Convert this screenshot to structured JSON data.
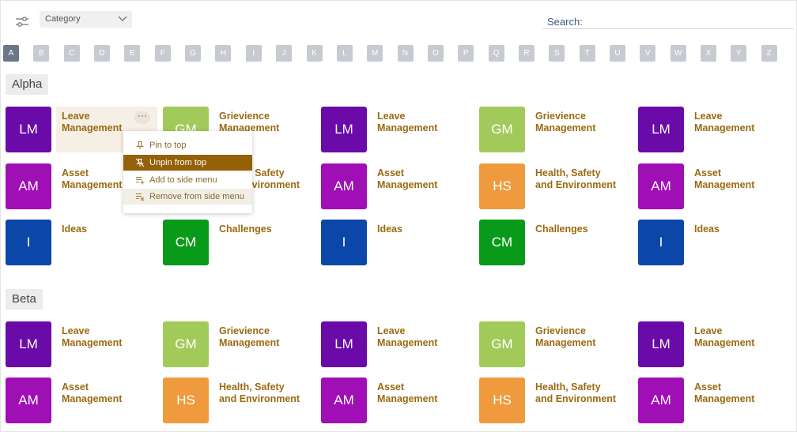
{
  "toolbar": {
    "filter_icon": "filter-sliders-icon",
    "category_label": "Category",
    "search_label": "Search:",
    "search_value": ""
  },
  "letters": [
    "A",
    "B",
    "C",
    "D",
    "E",
    "F",
    "G",
    "H",
    "I",
    "J",
    "K",
    "L",
    "M",
    "N",
    "O",
    "P",
    "Q",
    "R",
    "S",
    "T",
    "U",
    "V",
    "W",
    "X",
    "Y",
    "Z"
  ],
  "active_letter": "A",
  "colors": {
    "purple": "#6a0aa8",
    "magenta": "#a00fb6",
    "lime": "#a2ca5a",
    "orange": "#ef9a3d",
    "green": "#0a9a1a",
    "blue": "#0a47a8",
    "label": "#9a6a12",
    "menu_selected": "#946008"
  },
  "sections": [
    {
      "title": "Alpha",
      "rows": [
        [
          {
            "abbr": "LM",
            "label": [
              "Leave",
              "Management"
            ],
            "color": "#6a0aa8"
          },
          {
            "abbr": "GM",
            "label": [
              "Grievience",
              "Management"
            ],
            "color": "#a2ca5a"
          },
          {
            "abbr": "LM",
            "label": [
              "Leave",
              "Management"
            ],
            "color": "#6a0aa8"
          },
          {
            "abbr": "GM",
            "label": [
              "Grievience",
              "Management"
            ],
            "color": "#a2ca5a"
          },
          {
            "abbr": "LM",
            "label": [
              "Leave",
              "Management"
            ],
            "color": "#6a0aa8"
          }
        ],
        [
          {
            "abbr": "AM",
            "label": [
              "Asset",
              "Management"
            ],
            "color": "#a00fb6"
          },
          {
            "abbr": "HS",
            "label": [
              "Health, Safety",
              "and Environment"
            ],
            "color": "#ef9a3d"
          },
          {
            "abbr": "AM",
            "label": [
              "Asset",
              "Management"
            ],
            "color": "#a00fb6"
          },
          {
            "abbr": "HS",
            "label": [
              "Health, Safety",
              "and Environment"
            ],
            "color": "#ef9a3d"
          },
          {
            "abbr": "AM",
            "label": [
              "Asset",
              "Management"
            ],
            "color": "#a00fb6"
          }
        ],
        [
          {
            "abbr": "I",
            "label": [
              "Ideas",
              ""
            ],
            "color": "#0a47a8"
          },
          {
            "abbr": "CM",
            "label": [
              "Challenges",
              ""
            ],
            "color": "#0a9a1a"
          },
          {
            "abbr": "I",
            "label": [
              "Ideas",
              ""
            ],
            "color": "#0a47a8"
          },
          {
            "abbr": "CM",
            "label": [
              "Challenges",
              ""
            ],
            "color": "#0a9a1a"
          },
          {
            "abbr": "I",
            "label": [
              "Ideas",
              ""
            ],
            "color": "#0a47a8"
          }
        ]
      ]
    },
    {
      "title": "Beta",
      "rows": [
        [
          {
            "abbr": "LM",
            "label": [
              "Leave",
              "Management"
            ],
            "color": "#6a0aa8"
          },
          {
            "abbr": "GM",
            "label": [
              "Grievience",
              "Management"
            ],
            "color": "#a2ca5a"
          },
          {
            "abbr": "LM",
            "label": [
              "Leave",
              "Management"
            ],
            "color": "#6a0aa8"
          },
          {
            "abbr": "GM",
            "label": [
              "Grievience",
              "Management"
            ],
            "color": "#a2ca5a"
          },
          {
            "abbr": "LM",
            "label": [
              "Leave",
              "Management"
            ],
            "color": "#6a0aa8"
          }
        ],
        [
          {
            "abbr": "AM",
            "label": [
              "Asset",
              "Management"
            ],
            "color": "#a00fb6"
          },
          {
            "abbr": "HS",
            "label": [
              "Health, Safety",
              "and Environment"
            ],
            "color": "#ef9a3d"
          },
          {
            "abbr": "AM",
            "label": [
              "Asset",
              "Management"
            ],
            "color": "#a00fb6"
          },
          {
            "abbr": "HS",
            "label": [
              "Health, Safety",
              "and Environment"
            ],
            "color": "#ef9a3d"
          },
          {
            "abbr": "AM",
            "label": [
              "Asset",
              "Management"
            ],
            "color": "#a00fb6"
          }
        ]
      ]
    }
  ],
  "context_menu": {
    "more_glyph": "···",
    "items": [
      {
        "label": "Pin to top",
        "icon": "pin-icon",
        "state": ""
      },
      {
        "label": "Unpin from top",
        "icon": "unpin-icon",
        "state": "selected"
      },
      {
        "label": "Add to side menu",
        "icon": "add-list-icon",
        "state": ""
      },
      {
        "label": "Remove from side menu",
        "icon": "remove-list-icon",
        "state": "hovered"
      }
    ]
  }
}
